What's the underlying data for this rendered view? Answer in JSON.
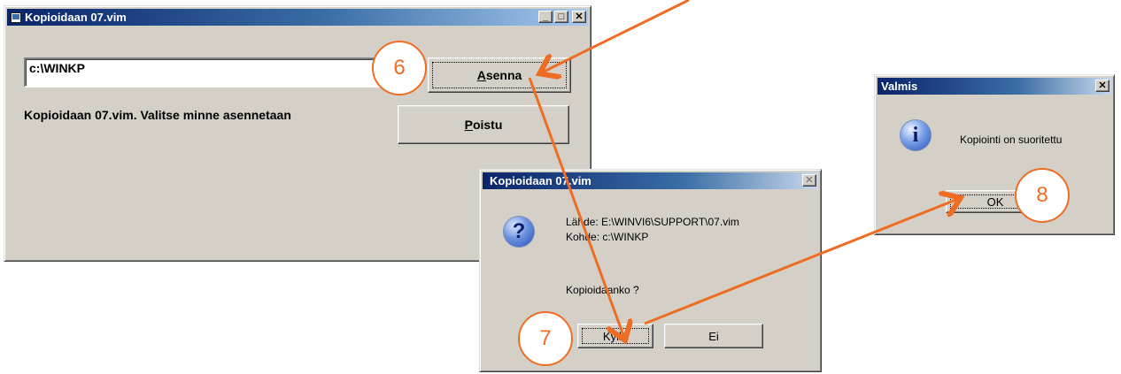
{
  "main_window": {
    "title": "Kopioidaan 07.vim",
    "path_value": "c:\\WINKP",
    "message": "Kopioidaan 07.vim. Valitse minne asennetaan",
    "install_button": "Asenna",
    "install_mnemonic": "A",
    "install_rest": "senna",
    "exit_mnemonic": "P",
    "exit_rest": "oistu",
    "minimize": "_",
    "maximize": "□",
    "close": "✕"
  },
  "confirm_dialog": {
    "title": "Kopioidaan 07.vim",
    "source_line": "Lähde: E:\\WINVI6\\SUPPORT\\07.vim",
    "target_line": "Kohde: c:\\WINKP",
    "question": "Kopioidaanko ?",
    "yes_button": "Kyllä",
    "no_button": "Ei",
    "close": "✕"
  },
  "done_dialog": {
    "title": "Valmis",
    "message": "Kopiointi on suoritettu",
    "ok_button": "OK",
    "close": "✕"
  },
  "steps": [
    "6",
    "7",
    "8"
  ],
  "colors": {
    "annotation": "#ee6d22",
    "titlebar_active": "#0a246a",
    "face": "#d4d0c8"
  },
  "icons": [
    "app-icon",
    "question-icon",
    "information-icon"
  ]
}
